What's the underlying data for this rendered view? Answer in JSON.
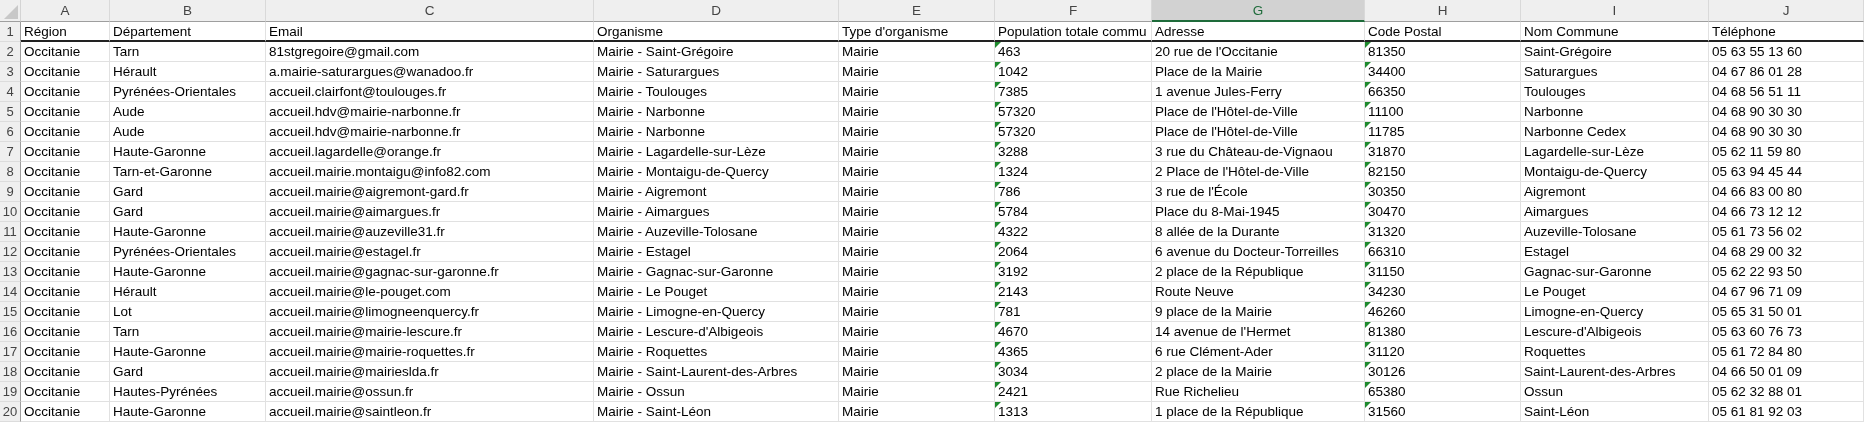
{
  "columns": [
    {
      "letter": "A",
      "heading": "Région",
      "selected": false,
      "error_marker": false
    },
    {
      "letter": "B",
      "heading": "Département",
      "selected": false,
      "error_marker": false
    },
    {
      "letter": "C",
      "heading": "Email",
      "selected": false,
      "error_marker": false
    },
    {
      "letter": "D",
      "heading": "Organisme",
      "selected": false,
      "error_marker": false
    },
    {
      "letter": "E",
      "heading": "Type d'organisme",
      "selected": false,
      "error_marker": false
    },
    {
      "letter": "F",
      "heading": "Population totale commu",
      "selected": false,
      "error_marker": true
    },
    {
      "letter": "G",
      "heading": "Adresse",
      "selected": true,
      "error_marker": false
    },
    {
      "letter": "H",
      "heading": "Code Postal",
      "selected": false,
      "error_marker": true
    },
    {
      "letter": "I",
      "heading": "Nom Commune",
      "selected": false,
      "error_marker": false
    },
    {
      "letter": "J",
      "heading": "Téléphone",
      "selected": false,
      "error_marker": false
    }
  ],
  "header_row": {
    "number": "1"
  },
  "rows": [
    {
      "number": "2",
      "cells": [
        "Occitanie",
        "Tarn",
        "81stgregoire@gmail.com",
        "Mairie - Saint-Grégoire",
        "Mairie",
        "463",
        "20 rue de l'Occitanie",
        "81350",
        "Saint-Grégoire",
        "05 63 55 13 60"
      ]
    },
    {
      "number": "3",
      "cells": [
        "Occitanie",
        "Hérault",
        "a.mairie-saturargues@wanadoo.fr",
        "Mairie - Saturargues",
        "Mairie",
        "1042",
        "Place de la Mairie",
        "34400",
        "Saturargues",
        "04 67 86 01 28"
      ]
    },
    {
      "number": "4",
      "cells": [
        "Occitanie",
        "Pyrénées-Orientales",
        "accueil.clairfont@toulouges.fr",
        "Mairie - Toulouges",
        "Mairie",
        "7385",
        "1 avenue Jules-Ferry",
        "66350",
        "Toulouges",
        "04 68 56 51 11"
      ]
    },
    {
      "number": "5",
      "cells": [
        "Occitanie",
        "Aude",
        "accueil.hdv@mairie-narbonne.fr",
        "Mairie - Narbonne",
        "Mairie",
        "57320",
        "Place de l'Hôtel-de-Ville",
        "11100",
        "Narbonne",
        "04 68 90 30 30"
      ]
    },
    {
      "number": "6",
      "cells": [
        "Occitanie",
        "Aude",
        "accueil.hdv@mairie-narbonne.fr",
        "Mairie - Narbonne",
        "Mairie",
        "57320",
        "Place de l'Hôtel-de-Ville",
        "11785",
        "Narbonne Cedex",
        "04 68 90 30 30"
      ]
    },
    {
      "number": "7",
      "cells": [
        "Occitanie",
        "Haute-Garonne",
        "accueil.lagardelle@orange.fr",
        "Mairie - Lagardelle-sur-Lèze",
        "Mairie",
        "3288",
        "3 rue du Château-de-Vignaou",
        "31870",
        "Lagardelle-sur-Lèze",
        "05 62 11 59 80"
      ]
    },
    {
      "number": "8",
      "cells": [
        "Occitanie",
        "Tarn-et-Garonne",
        "accueil.mairie.montaigu@info82.com",
        "Mairie - Montaigu-de-Quercy",
        "Mairie",
        "1324",
        "2 Place de l'Hôtel-de-Ville",
        "82150",
        "Montaigu-de-Quercy",
        "05 63 94 45 44"
      ]
    },
    {
      "number": "9",
      "cells": [
        "Occitanie",
        "Gard",
        "accueil.mairie@aigremont-gard.fr",
        "Mairie - Aigremont",
        "Mairie",
        "786",
        "3 rue de l'École",
        "30350",
        "Aigremont",
        "04 66 83 00 80"
      ]
    },
    {
      "number": "10",
      "cells": [
        "Occitanie",
        "Gard",
        "accueil.mairie@aimargues.fr",
        "Mairie - Aimargues",
        "Mairie",
        "5784",
        "Place du 8-Mai-1945",
        "30470",
        "Aimargues",
        "04 66 73 12 12"
      ]
    },
    {
      "number": "11",
      "cells": [
        "Occitanie",
        "Haute-Garonne",
        "accueil.mairie@auzeville31.fr",
        "Mairie - Auzeville-Tolosane",
        "Mairie",
        "4322",
        "8 allée de la Durante",
        "31320",
        "Auzeville-Tolosane",
        "05 61 73 56 02"
      ]
    },
    {
      "number": "12",
      "cells": [
        "Occitanie",
        "Pyrénées-Orientales",
        "accueil.mairie@estagel.fr",
        "Mairie - Estagel",
        "Mairie",
        "2064",
        "6 avenue du Docteur-Torreilles",
        "66310",
        "Estagel",
        "04 68 29 00 32"
      ]
    },
    {
      "number": "13",
      "cells": [
        "Occitanie",
        "Haute-Garonne",
        "accueil.mairie@gagnac-sur-garonne.fr",
        "Mairie - Gagnac-sur-Garonne",
        "Mairie",
        "3192",
        "2 place de la République",
        "31150",
        "Gagnac-sur-Garonne",
        "05 62 22 93 50"
      ]
    },
    {
      "number": "14",
      "cells": [
        "Occitanie",
        "Hérault",
        "accueil.mairie@le-pouget.com",
        "Mairie - Le Pouget",
        "Mairie",
        "2143",
        "Route Neuve",
        "34230",
        "Le Pouget",
        "04 67 96 71 09"
      ]
    },
    {
      "number": "15",
      "cells": [
        "Occitanie",
        "Lot",
        "accueil.mairie@limogneenquercy.fr",
        "Mairie - Limogne-en-Quercy",
        "Mairie",
        "781",
        "9 place de la Mairie",
        "46260",
        "Limogne-en-Quercy",
        "05 65 31 50 01"
      ]
    },
    {
      "number": "16",
      "cells": [
        "Occitanie",
        "Tarn",
        "accueil.mairie@mairie-lescure.fr",
        "Mairie - Lescure-d'Albigeois",
        "Mairie",
        "4670",
        "14 avenue de l'Hermet",
        "81380",
        "Lescure-d'Albigeois",
        "05 63 60 76 73"
      ]
    },
    {
      "number": "17",
      "cells": [
        "Occitanie",
        "Haute-Garonne",
        "accueil.mairie@mairie-roquettes.fr",
        "Mairie - Roquettes",
        "Mairie",
        "4365",
        "6 rue Clément-Ader",
        "31120",
        "Roquettes",
        "05 61 72 84 80"
      ]
    },
    {
      "number": "18",
      "cells": [
        "Occitanie",
        "Gard",
        "accueil.mairie@mairieslda.fr",
        "Mairie - Saint-Laurent-des-Arbres",
        "Mairie",
        "3034",
        "2 place de la Mairie",
        "30126",
        "Saint-Laurent-des-Arbres",
        "04 66 50 01 09"
      ]
    },
    {
      "number": "19",
      "cells": [
        "Occitanie",
        "Hautes-Pyrénées",
        "accueil.mairie@ossun.fr",
        "Mairie - Ossun",
        "Mairie",
        "2421",
        "Rue Richelieu",
        "65380",
        "Ossun",
        "05 62 32 88 01"
      ]
    },
    {
      "number": "20",
      "cells": [
        "Occitanie",
        "Haute-Garonne",
        "accueil.mairie@saintleon.fr",
        "Mairie - Saint-Léon",
        "Mairie",
        "1313",
        "1 place de la République",
        "31560",
        "Saint-Léon",
        "05 61 81 92 03"
      ]
    }
  ]
}
